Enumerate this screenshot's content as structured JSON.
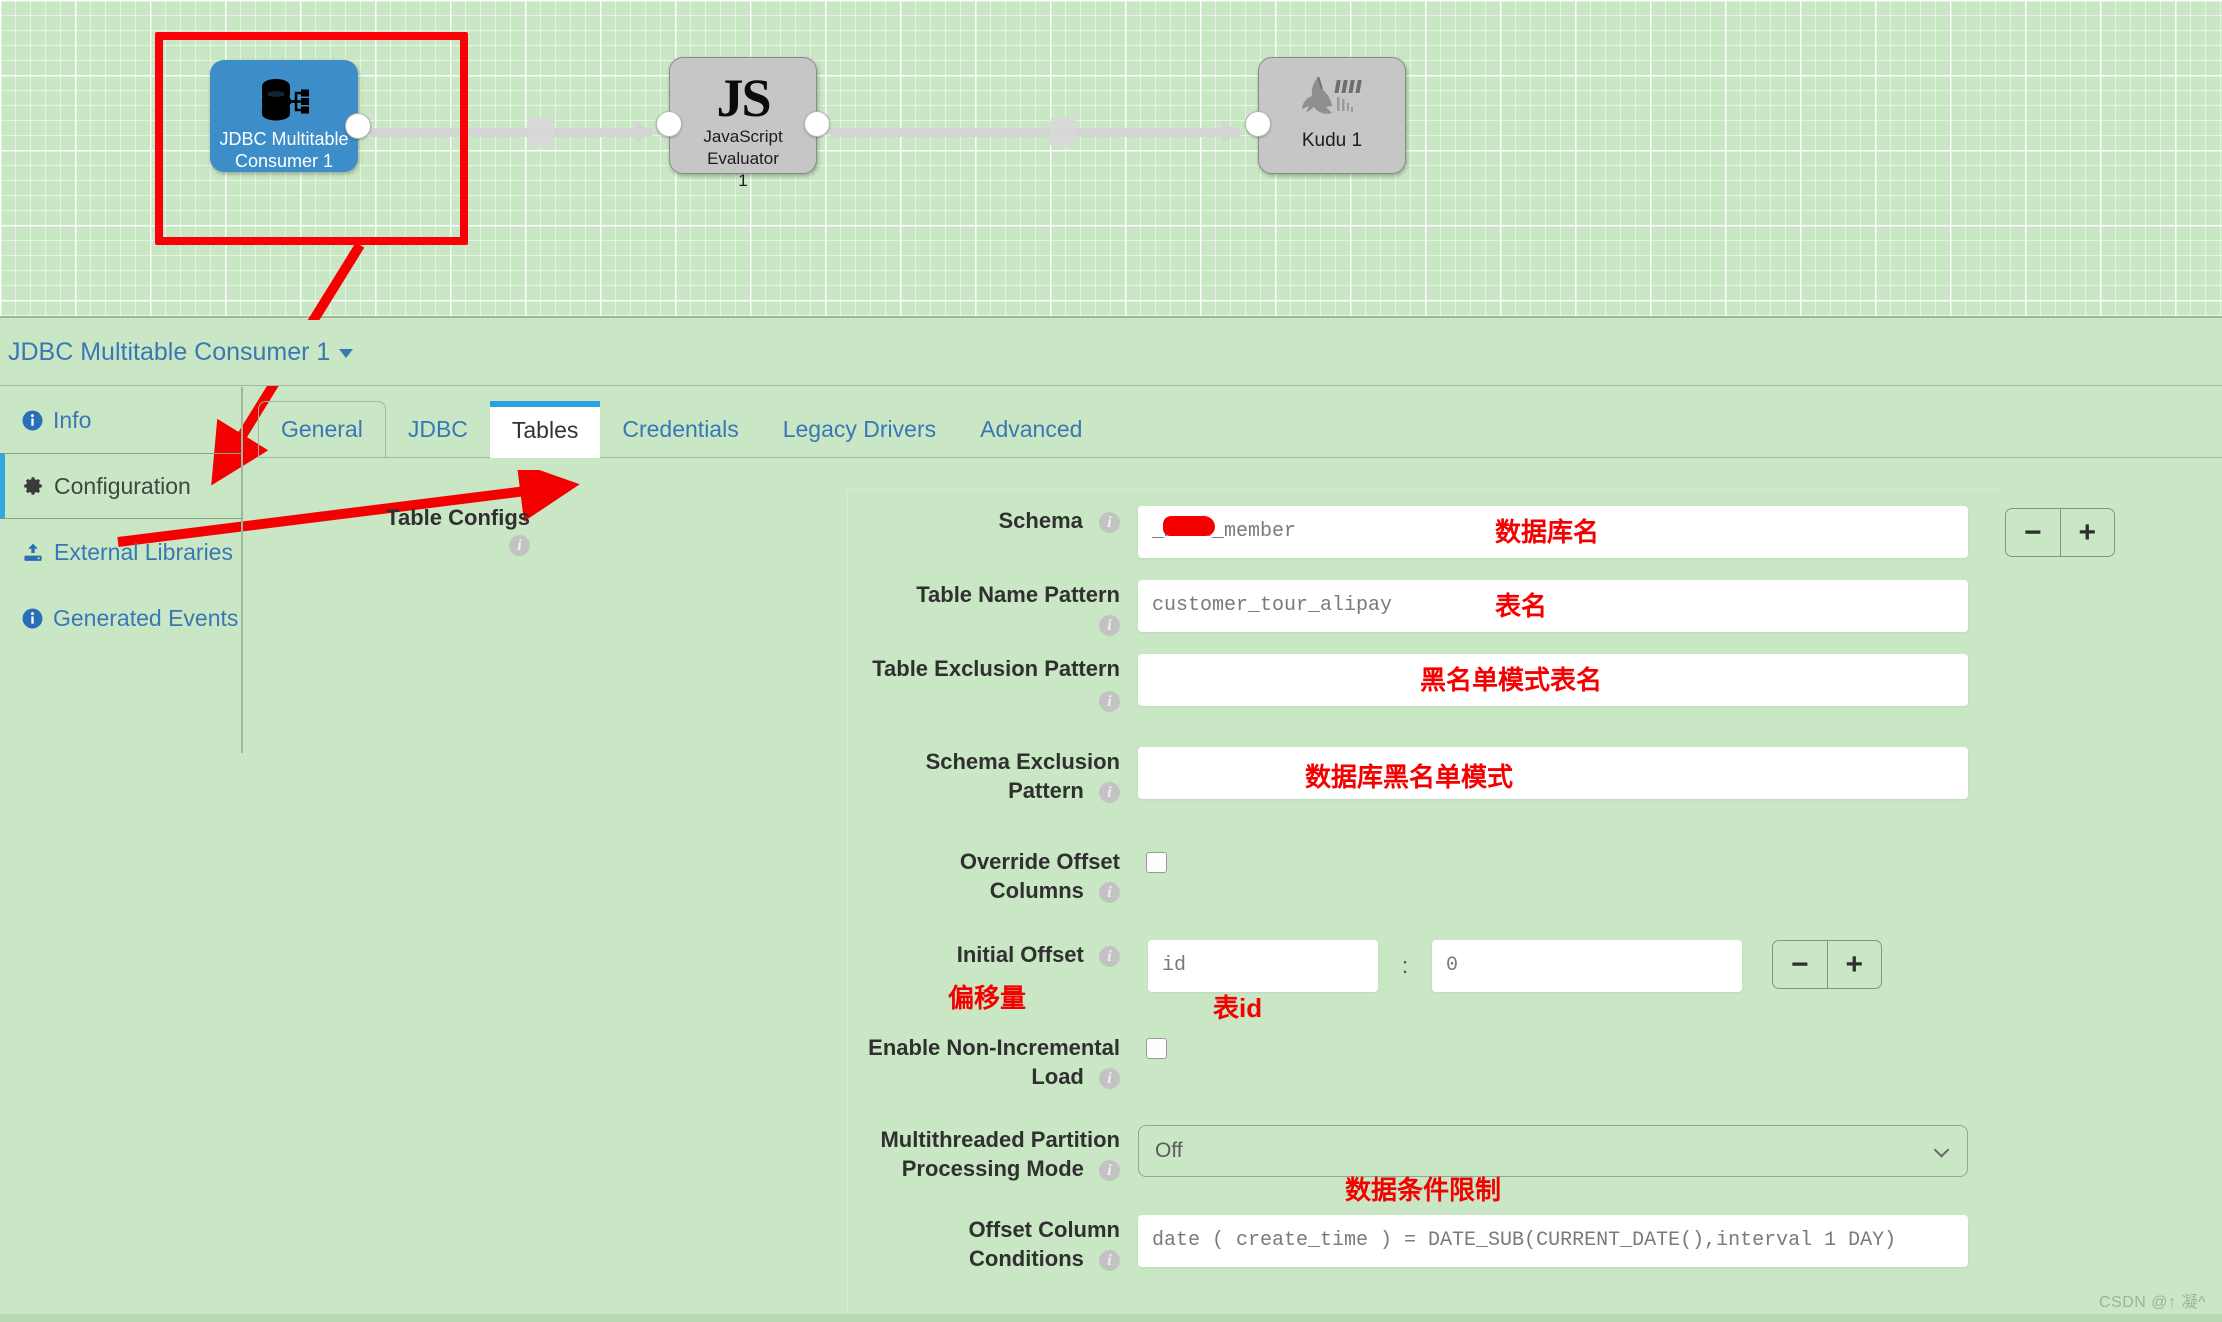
{
  "pipeline": {
    "nodes": [
      {
        "id": "jdbc",
        "label": "JDBC Multitable\nConsumer 1",
        "label_line1": "JDBC Multitable",
        "label_line2": "Consumer 1",
        "icon": "database-pipeline-icon",
        "color": "#3c8dc8"
      },
      {
        "id": "js",
        "label_line1": "JavaScript Evaluator",
        "label_line2": "1",
        "icon": "js-icon",
        "glyph": "JS",
        "color": "#c6c6c6"
      },
      {
        "id": "kudu",
        "label_line1": "Kudu 1",
        "label_line2": "",
        "icon": "kudu-antelope-icon",
        "color": "#c6c6c6"
      }
    ]
  },
  "stage_header": {
    "title": "JDBC Multitable Consumer 1"
  },
  "sidebar": {
    "items": [
      {
        "label": "Info",
        "icon": "info-icon",
        "active": false
      },
      {
        "label": "Configuration",
        "icon": "gear-icon",
        "active": true
      },
      {
        "label": "External Libraries",
        "icon": "upload-icon",
        "active": false
      },
      {
        "label": "Generated Events",
        "icon": "info-icon",
        "active": false
      }
    ]
  },
  "tabs": [
    {
      "label": "General",
      "active": false
    },
    {
      "label": "JDBC",
      "active": false
    },
    {
      "label": "Tables",
      "active": true
    },
    {
      "label": "Credentials",
      "active": false
    },
    {
      "label": "Legacy Drivers",
      "active": false
    },
    {
      "label": "Advanced",
      "active": false
    }
  ],
  "form": {
    "group_label": "Table Configs",
    "fields": {
      "schema": {
        "label": "Schema",
        "value": "_mind_member"
      },
      "table_name_pattern": {
        "label": "Table Name Pattern",
        "value": "customer_tour_alipay"
      },
      "table_exclusion_pattern": {
        "label": "Table Exclusion Pattern",
        "value": ""
      },
      "schema_exclusion_pattern": {
        "label": "Schema Exclusion Pattern",
        "label_line1": "Schema Exclusion",
        "label_line2": "Pattern",
        "value": ""
      },
      "override_offset_columns": {
        "label": "Override Offset Columns",
        "label_line1": "Override Offset",
        "label_line2": "Columns",
        "checked": false
      },
      "initial_offset": {
        "label": "Initial Offset",
        "key": "id",
        "separator": ":",
        "value": "0"
      },
      "enable_non_incremental_load": {
        "label": "Enable Non-Incremental Load",
        "label_line1": "Enable Non-Incremental",
        "label_line2": "Load",
        "checked": false
      },
      "multithreaded_partition_processing_mode": {
        "label": "Multithreaded Partition Processing Mode",
        "label_line1": "Multithreaded Partition",
        "label_line2": "Processing Mode",
        "value": "Off"
      },
      "offset_column_conditions": {
        "label": "Offset Column Conditions",
        "label_line1": "Offset Column",
        "label_line2": "Conditions",
        "value": "date ( create_time ) = DATE_SUB(CURRENT_DATE(),interval 1 DAY)"
      }
    },
    "stepper": {
      "minus": "−",
      "plus": "+"
    }
  },
  "annotations": [
    {
      "text": "数据库名",
      "meaning": "database name"
    },
    {
      "text": "表名",
      "meaning": "table name"
    },
    {
      "text": "黑名单模式表名",
      "meaning": "blacklist pattern table name"
    },
    {
      "text": "数据库黑名单模式",
      "meaning": "database blacklist pattern"
    },
    {
      "text": "偏移量",
      "meaning": "offset"
    },
    {
      "text": "表id",
      "meaning": "table id"
    },
    {
      "text": "数据条件限制",
      "meaning": "data condition restriction"
    }
  ],
  "watermark": "CSDN @↑ 凝^",
  "colors": {
    "accent": "#29a3e0",
    "link": "#3a77b5",
    "annotation_red": "#f50000",
    "canvas_green": "#c9e7c4",
    "node_blue": "#3c8dc8"
  }
}
